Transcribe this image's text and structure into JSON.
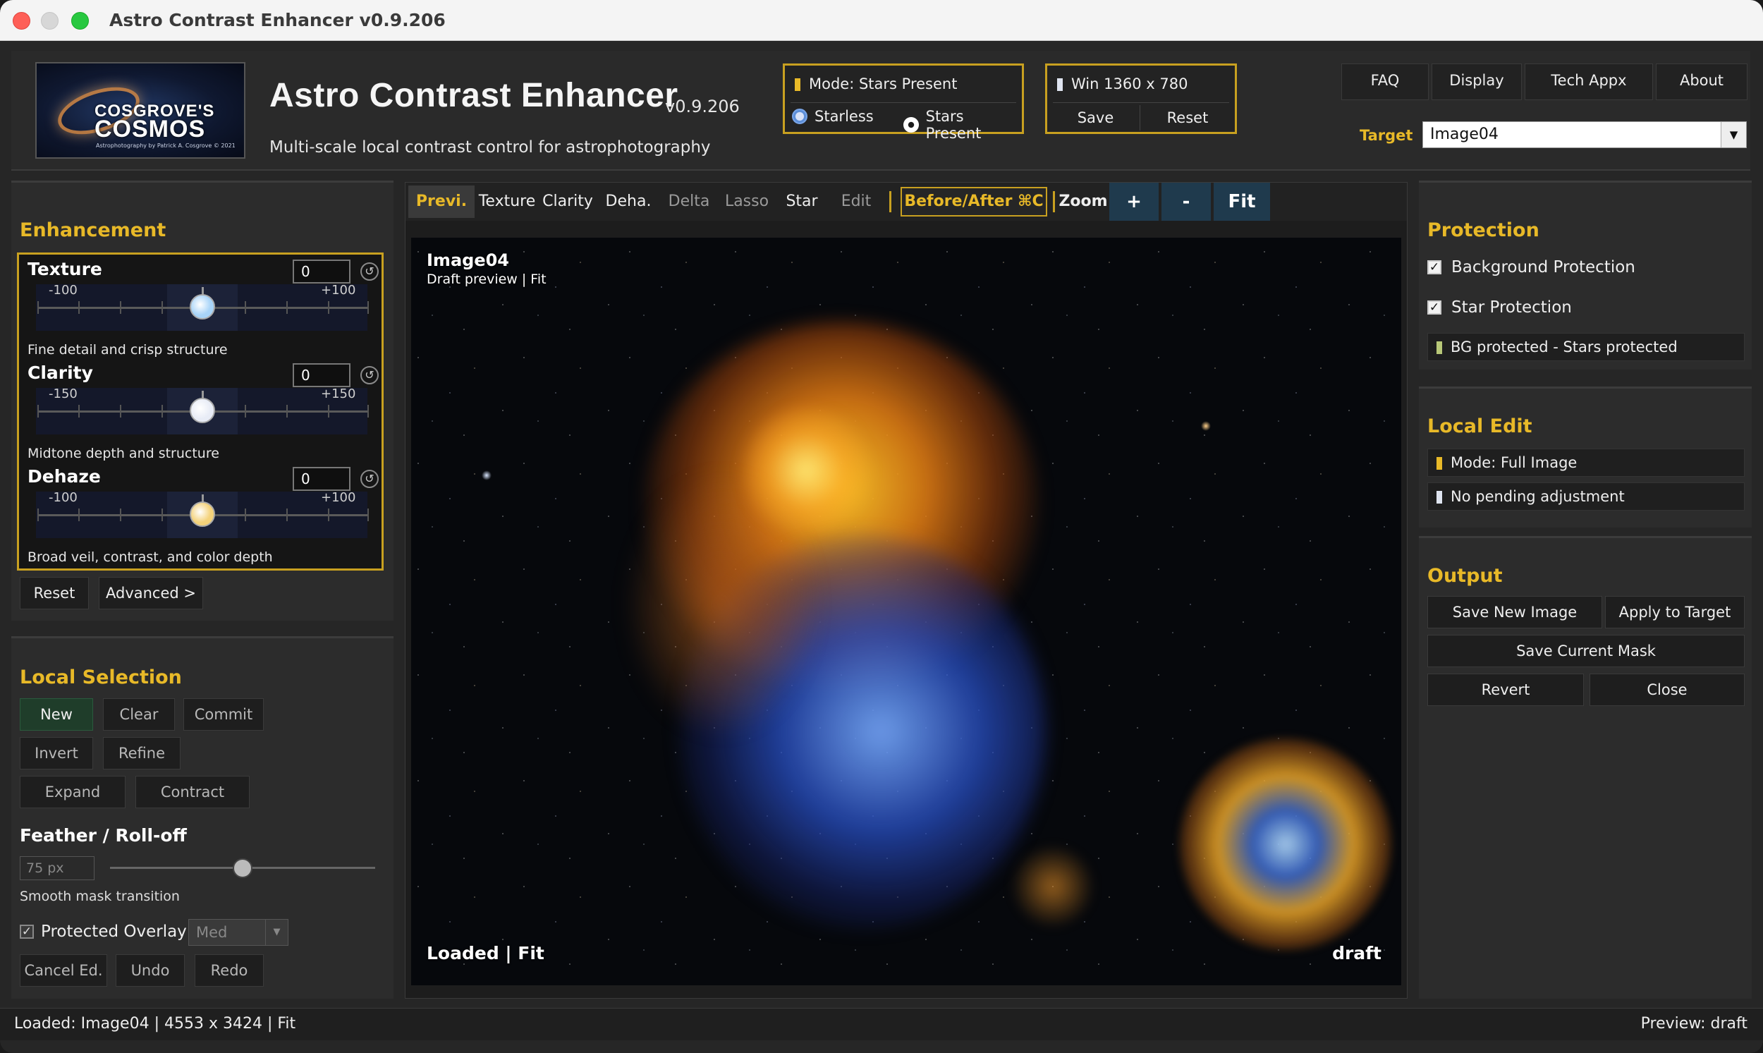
{
  "window": {
    "title": "Astro Contrast Enhancer v0.9.206"
  },
  "header": {
    "logo": {
      "line1": "COSGROVE'S",
      "line2": "COSMOS",
      "line3": "Astrophotography by Patrick A. Cosgrove © 2021"
    },
    "app_title": "Astro Contrast Enhancer",
    "version": "v0.9.206",
    "subtitle": "Multi-scale local contrast control for astrophotography",
    "mode": {
      "status": "Mode: Stars Present",
      "option_starless": "Starless",
      "option_stars": "Stars Present",
      "selected": "Stars Present"
    },
    "window_size": {
      "label": "Win 1360 x 780",
      "save": "Save",
      "reset": "Reset"
    },
    "nav": [
      "FAQ",
      "Display",
      "Tech Appx",
      "About"
    ],
    "target": {
      "label": "Target",
      "value": "Image04"
    }
  },
  "enhancement": {
    "title": "Enhancement",
    "sliders": [
      {
        "name": "Texture",
        "value": "0",
        "min": "-100",
        "max": "+100",
        "desc": "Fine detail and crisp structure",
        "knob_color": "#a8d4f8"
      },
      {
        "name": "Clarity",
        "value": "0",
        "min": "-150",
        "max": "+150",
        "desc": "Midtone depth and structure",
        "knob_color": "#e8ecf6"
      },
      {
        "name": "Dehaze",
        "value": "0",
        "min": "-100",
        "max": "+100",
        "desc": "Broad veil, contrast, and color depth",
        "knob_color": "#f4d27a"
      }
    ],
    "reset": "Reset",
    "advanced": "Advanced >"
  },
  "local_selection": {
    "title": "Local Selection",
    "buttons": {
      "new": "New",
      "clear": "Clear",
      "commit": "Commit",
      "invert": "Invert",
      "refine": "Refine",
      "expand": "Expand",
      "contract": "Contract"
    },
    "feather_title": "Feather / Roll-off",
    "feather_value": "75 px",
    "feather_level": 0.5,
    "feather_desc": "Smooth mask transition",
    "protected_overlay": "Protected Overlay",
    "overlay_level": "Med",
    "cancel": "Cancel Ed.",
    "undo": "Undo",
    "redo": "Redo"
  },
  "preview": {
    "tabs": [
      "Previ.",
      "Texture",
      "Clarity",
      "Deha.",
      "Delta",
      "Lasso",
      "Star",
      "Edit"
    ],
    "active_tab": "Previ.",
    "before_after": "Before/After ⌘C",
    "zoom_label": "Zoom",
    "zoom_in": "+",
    "zoom_out": "-",
    "fit": "Fit",
    "image_name": "Image04",
    "image_sub": "Draft preview | Fit",
    "bottom_left": "Loaded | Fit",
    "bottom_right": "draft"
  },
  "protection": {
    "title": "Protection",
    "background": "Background Protection",
    "star": "Star Protection",
    "status": "BG protected - Stars protected"
  },
  "local_edit": {
    "title": "Local Edit",
    "mode": "Mode: Full Image",
    "pending": "No pending adjustment"
  },
  "output": {
    "title": "Output",
    "save_new": "Save New Image",
    "apply": "Apply to Target",
    "save_mask": "Save Current Mask",
    "revert": "Revert",
    "close": "Close"
  },
  "status": {
    "left": "Loaded: Image04 | 4553 x 3424 | Fit",
    "right": "Preview: draft"
  },
  "colors": {
    "accent": "#e8b928",
    "panel": "#2c2c2c",
    "zoom_button": "#1f3a4d",
    "new_button": "#1f3d2a"
  }
}
